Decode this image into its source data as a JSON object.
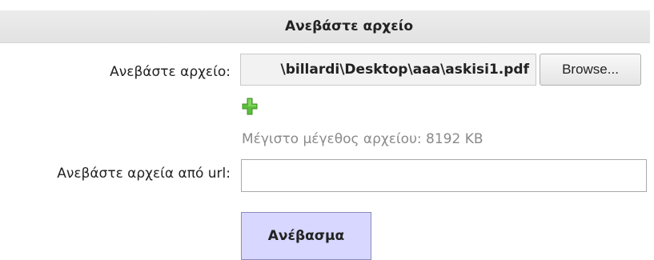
{
  "header": {
    "title": "Ανεβάστε αρχείο"
  },
  "file_row": {
    "label": "Ανεβάστε αρχείο:",
    "path_value": "\\billardi\\Desktop\\aaa\\askisi1.pdf",
    "browse_label": "Browse...",
    "add_icon": "add-green-plus-icon",
    "max_size_text": "Μέγιστο μέγεθος αρχείου: 8192 KB"
  },
  "url_row": {
    "label": "Ανεβάστε αρχεία από url:",
    "value": ""
  },
  "submit": {
    "label": "Ανέβασμα"
  },
  "colors": {
    "header_bg": "#e6e6e6",
    "submit_bg": "#d7d7ff",
    "add_icon_green": "#5cbf3a",
    "hint_text": "#8a8a8a"
  }
}
